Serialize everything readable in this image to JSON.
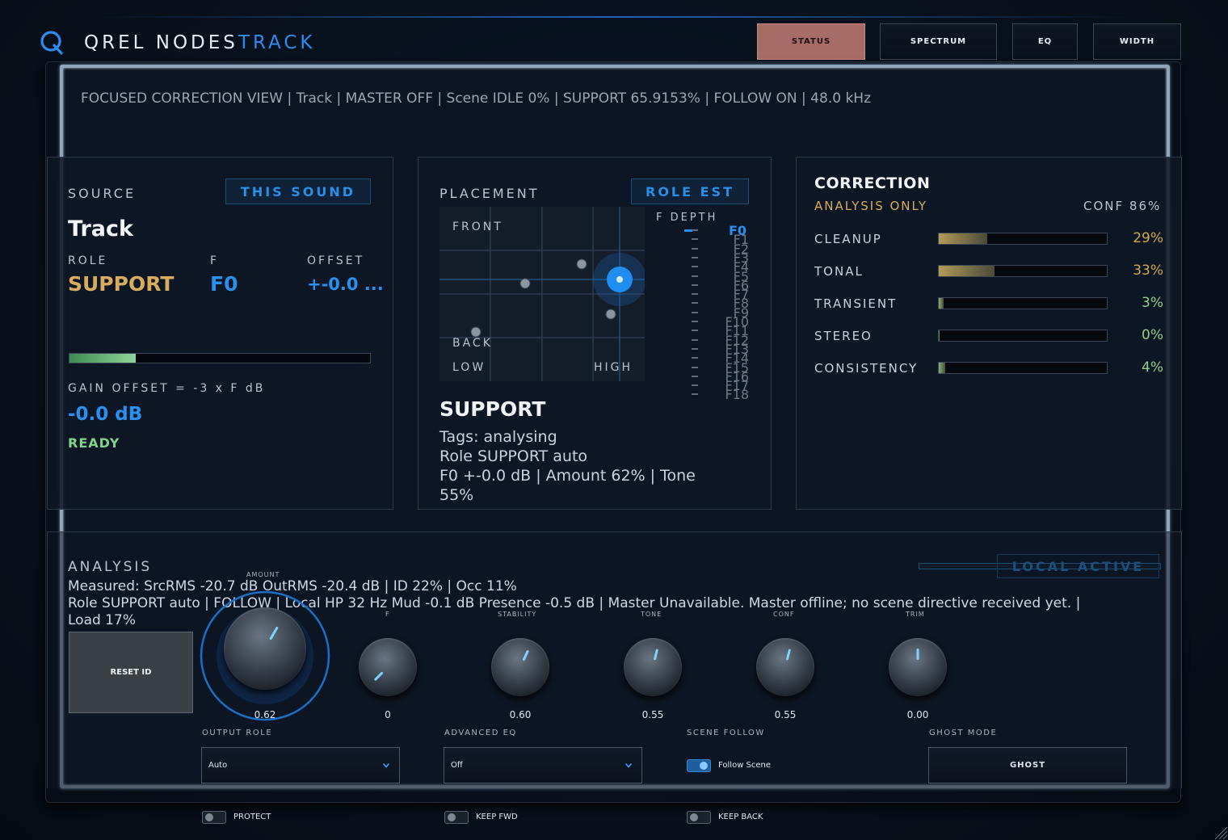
{
  "app": {
    "brand_main": "QREL NODES",
    "brand_accent": "TRACK"
  },
  "tabs": [
    "STATUS",
    "SPECTRUM",
    "EQ",
    "WIDTH"
  ],
  "status_line": "FOCUSED CORRECTION VIEW | Track | MASTER OFF | Scene IDLE 0% | SUPPORT 65.9153% | FOLLOW ON | 48.0 kHz",
  "source": {
    "title": "SOURCE",
    "pill": "THIS SOUND",
    "name": "Track",
    "role_label": "ROLE",
    "role_value": "SUPPORT",
    "f_label": "F",
    "f_value": "F0",
    "offset_label": "OFFSET",
    "offset_value": "+-0.0 ...",
    "meter_level": 0.22,
    "gain_formula": "GAIN OFFSET = -3 x F dB",
    "gain_value": "-0.0 dB",
    "state": "READY"
  },
  "placement": {
    "title": "PLACEMENT",
    "pill": "ROLE EST",
    "front": "FRONT",
    "back": "BACK",
    "low": "LOW",
    "high": "HIGH",
    "depth_label": "F DEPTH",
    "depth_items": [
      "F0",
      "F1",
      "F2",
      "F3",
      "F4",
      "F5",
      "F6",
      "F7",
      "F8",
      "F9",
      "F10",
      "F11",
      "F12",
      "F13",
      "F14",
      "F15",
      "F16",
      "F17",
      "F18"
    ],
    "role_title": "SUPPORT",
    "desc_lines": [
      "Tags: analysing",
      "Role SUPPORT auto",
      "F0 +-0.0 dB | Amount 62% | Tone",
      "55%"
    ]
  },
  "correction": {
    "title": "CORRECTION",
    "mode": "ANALYSIS ONLY",
    "conf": "CONF 86%",
    "rows": [
      {
        "label": "CLEANUP",
        "pct": "29%",
        "value": 0.29,
        "color": "#b29a58",
        "pct_color": "#d2a94a"
      },
      {
        "label": "TONAL",
        "pct": "33%",
        "value": 0.33,
        "color": "#b29a58",
        "pct_color": "#d2a94a"
      },
      {
        "label": "TRANSIENT",
        "pct": "3%",
        "value": 0.03,
        "color": "#7fb07a",
        "pct_color": "#8fd08a"
      },
      {
        "label": "STEREO",
        "pct": "0%",
        "value": 0.0,
        "color": "#7fb07a",
        "pct_color": "#8fd08a"
      },
      {
        "label": "CONSISTENCY",
        "pct": "4%",
        "value": 0.04,
        "color": "#7fb07a",
        "pct_color": "#8fd08a"
      }
    ]
  },
  "analysis": {
    "title": "ANALYSIS",
    "badge": "LOCAL ACTIVE",
    "line1": "Measured: SrcRMS -20.7 dB  OutRMS -20.4 dB | ID 22% | Occ 11%",
    "line2": "Role SUPPORT auto | FOLLOW | Local HP 32 Hz  Mud -0.1 dB  Presence -0.5 dB | Master Unavailable. Master offline; no scene directive received yet. |",
    "line3": "Load 17%"
  },
  "controls": {
    "reset_id": "RESET ID",
    "knobs": [
      {
        "caption": "AMOUNT",
        "value": "0.62"
      },
      {
        "caption": "F",
        "value": "0"
      },
      {
        "caption": "STABILITY",
        "value": "0.60"
      },
      {
        "caption": "TONE",
        "value": "0.55"
      },
      {
        "caption": "CONF",
        "value": "0.55"
      },
      {
        "caption": "TRIM",
        "value": "0.00"
      }
    ],
    "output_role_label": "OUTPUT ROLE",
    "output_role_value": "Auto",
    "advanced_eq_label": "ADVANCED EQ",
    "advanced_eq_value": "Off",
    "scene_follow_label": "SCENE FOLLOW",
    "follow_scene": "Follow Scene",
    "ghost_mode_label": "GHOST MODE",
    "ghost_button": "GHOST",
    "protect": "PROTECT",
    "keep_fwd": "KEEP FWD",
    "keep_back": "KEEP BACK"
  }
}
